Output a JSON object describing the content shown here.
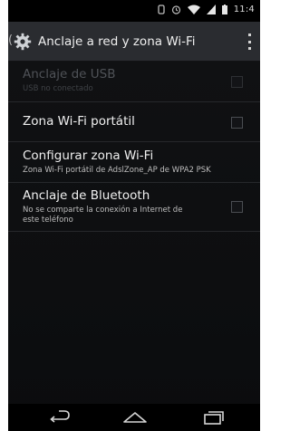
{
  "status_bar": {
    "time": "11:4",
    "icons": [
      "notification-icon",
      "alarm-icon",
      "wifi-icon",
      "signal-icon",
      "battery-icon"
    ]
  },
  "action_bar": {
    "title": "Anclaje a red y zona Wi-Fi"
  },
  "settings": [
    {
      "title": "Anclaje de USB",
      "summary": "USB no conectado",
      "enabled": false,
      "has_checkbox": true,
      "checked": false
    },
    {
      "title": "Zona Wi-Fi portátil",
      "summary": "",
      "enabled": true,
      "has_checkbox": true,
      "checked": false
    },
    {
      "title": "Configurar zona Wi-Fi",
      "summary": "Zona Wi-Fi portátil de AdslZone_AP de WPA2 PSK",
      "enabled": true,
      "has_checkbox": false
    },
    {
      "title": "Anclaje de Bluetooth",
      "summary_line1": "No se comparte la conexión a Internet de",
      "summary_line2": "este teléfono",
      "enabled": true,
      "has_checkbox": true,
      "checked": false
    }
  ],
  "navigation": [
    "back-icon",
    "home-icon",
    "recents-icon"
  ],
  "colors": {
    "background": "#0b0c0e",
    "action_bar": "#2a2c30",
    "accent": "#33b5e5"
  }
}
